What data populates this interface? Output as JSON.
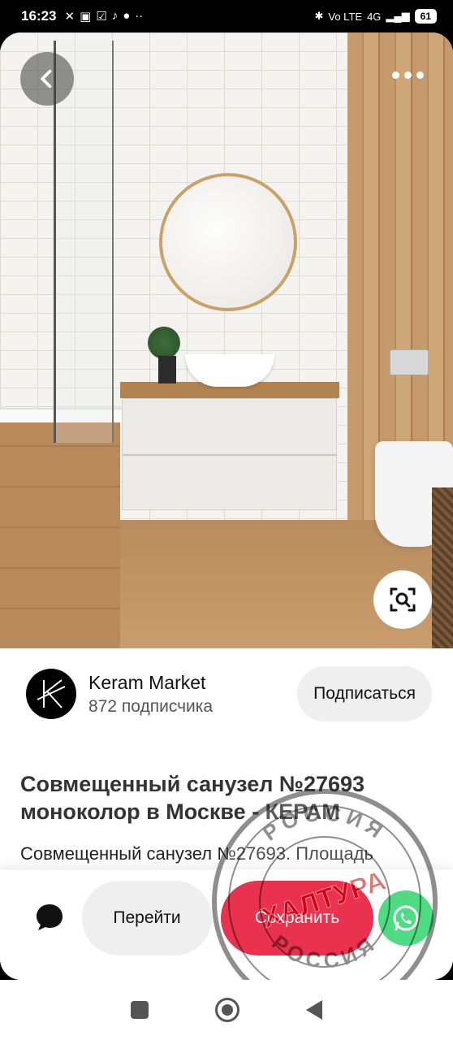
{
  "status_bar": {
    "time": "16:23",
    "network": "4G",
    "volte": "Vo LTE",
    "battery": "61"
  },
  "pin": {
    "title": "Совмещенный санузел №27693 моноколор в Москве - КЕРАМ",
    "description": "Совмещенный санузел №27693. Площадь"
  },
  "profile": {
    "name": "Keram Market",
    "subscribers": "872 подписчика",
    "follow_label": "Подписаться"
  },
  "actions": {
    "go_label": "Перейти",
    "save_label": "Сохранить"
  },
  "watermark": {
    "text_top": "РОССИЯ",
    "text_middle": "ХАЛТУРА",
    "text_bottom": "РОССИЯ"
  },
  "colors": {
    "save": "#e60023",
    "whatsapp": "#25d366",
    "pill": "#efefef"
  },
  "icons": {
    "back": "chevron-left-icon",
    "more": "more-dots-icon",
    "lens": "visual-search-icon",
    "comment": "comment-bubble-icon",
    "share": "whatsapp-icon"
  }
}
